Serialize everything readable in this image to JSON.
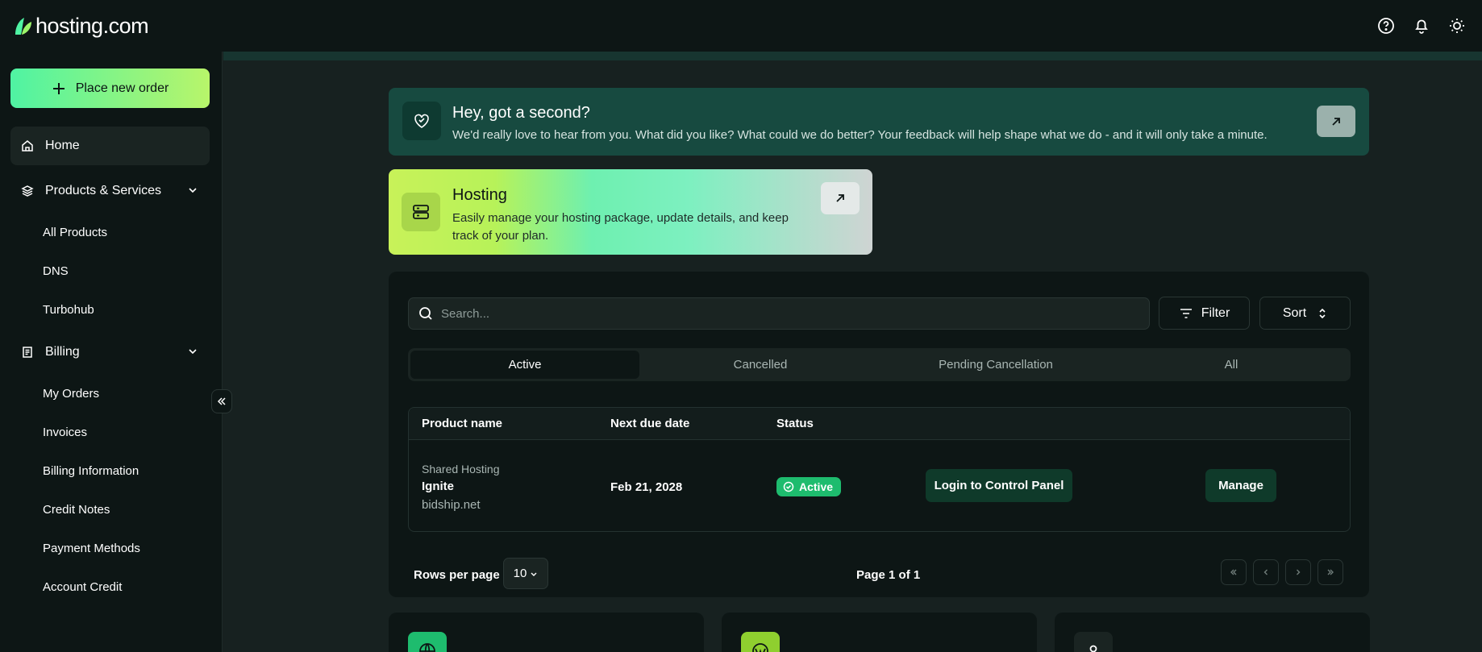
{
  "brand": {
    "name": "hosting.com",
    "accent": "#4ff3a3"
  },
  "header": {
    "icons": [
      "help-circle-icon",
      "bell-icon",
      "sun-icon"
    ]
  },
  "sidebar": {
    "order_button": "Place new order",
    "home": "Home",
    "products": {
      "label": "Products & Services",
      "items": [
        "All Products",
        "DNS",
        "Turbohub"
      ]
    },
    "billing": {
      "label": "Billing",
      "items": [
        "My Orders",
        "Invoices",
        "Billing Information",
        "Credit Notes",
        "Payment Methods",
        "Account Credit"
      ]
    }
  },
  "feedback": {
    "title": "Hey, got a second?",
    "description": "We'd really love to hear from you. What did you like? What could we do better? Your feedback will help shape what we do - and it will only take a minute."
  },
  "hosting_card": {
    "title": "Hosting",
    "description": "Easily manage your hosting package, update details, and keep track of your plan."
  },
  "search": {
    "placeholder": "Search...",
    "value": ""
  },
  "toolbar": {
    "filter": "Filter",
    "sort": "Sort"
  },
  "tabs": [
    "Active",
    "Cancelled",
    "Pending Cancellation",
    "All"
  ],
  "active_tab": "Active",
  "table": {
    "columns": [
      "Product name",
      "Next due date",
      "Status"
    ],
    "rows": [
      {
        "type": "Shared Hosting",
        "name": "Ignite",
        "domain": "bidship.net",
        "next_due": "Feb 21, 2028",
        "status": "Active",
        "login_action": "Login to Control Panel",
        "manage_action": "Manage"
      }
    ]
  },
  "pagination": {
    "rows_per_page_label": "Rows per page",
    "rows_per_page": "10",
    "page_label": "Page 1 of 1"
  }
}
